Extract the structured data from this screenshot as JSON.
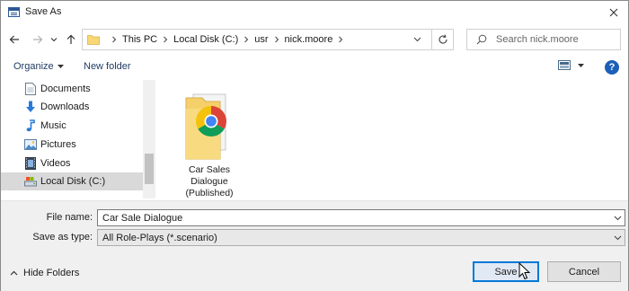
{
  "window": {
    "title": "Save As"
  },
  "nav": {
    "back_icon": "arrow-left-icon",
    "forward_icon": "arrow-right-icon",
    "recent_icon": "chevron-down-icon",
    "up_icon": "arrow-up-icon",
    "breadcrumbs": [
      "This PC",
      "Local Disk (C:)",
      "usr",
      "nick.moore"
    ],
    "search_placeholder": "Search nick.moore"
  },
  "toolbar": {
    "organize_label": "Organize",
    "new_folder_label": "New folder",
    "help_label": "?"
  },
  "sidebar": {
    "items": [
      {
        "label": "Documents",
        "icon": "documents-icon",
        "selected": false
      },
      {
        "label": "Downloads",
        "icon": "downloads-icon",
        "selected": false
      },
      {
        "label": "Music",
        "icon": "music-icon",
        "selected": false
      },
      {
        "label": "Pictures",
        "icon": "pictures-icon",
        "selected": false
      },
      {
        "label": "Videos",
        "icon": "videos-icon",
        "selected": false
      },
      {
        "label": "Local Disk (C:)",
        "icon": "drive-icon",
        "selected": true
      }
    ]
  },
  "files": [
    {
      "name_lines": [
        "Car Sales",
        "Dialogue",
        "(Published)"
      ],
      "icon": "chrome-folder-icon"
    }
  ],
  "form": {
    "file_name_label": "File name:",
    "file_name_value": "Car Sale Dialogue",
    "save_type_label": "Save as type:",
    "save_type_value": "All Role-Plays (*.scenario)"
  },
  "footer": {
    "hide_folders_label": "Hide Folders",
    "save_label": "Save",
    "cancel_label": "Cancel"
  },
  "colors": {
    "accent": "#0078d7",
    "help_blue": "#1c5fb8",
    "panel_bg": "#f0f0f0",
    "link_text": "#1f3b64"
  }
}
